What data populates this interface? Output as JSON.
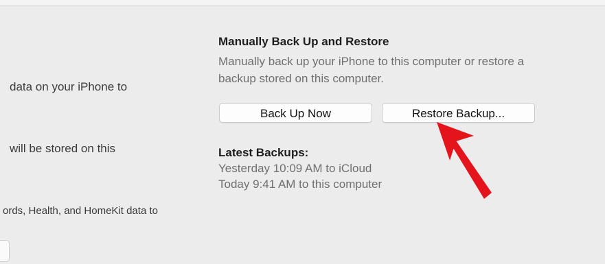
{
  "left_panel": {
    "fragments": [
      "data on your iPhone to",
      "will be stored on this",
      "ords, Health, and HomeKit data to"
    ]
  },
  "manual_section": {
    "title": "Manually Back Up and Restore",
    "description_lines": [
      "Manually back up your iPhone to this computer or restore a",
      "backup stored on this computer."
    ],
    "back_up_now_label": "Back Up Now",
    "restore_backup_label": "Restore Backup..."
  },
  "latest_backups": {
    "title": "Latest Backups:",
    "entries": [
      "Yesterday 10:09 AM to iCloud",
      "Today 9:41 AM to this computer"
    ]
  },
  "annotation": {
    "arrow_color": "#e3141b",
    "arrow_icon": "red-pointer-arrow-icon"
  }
}
